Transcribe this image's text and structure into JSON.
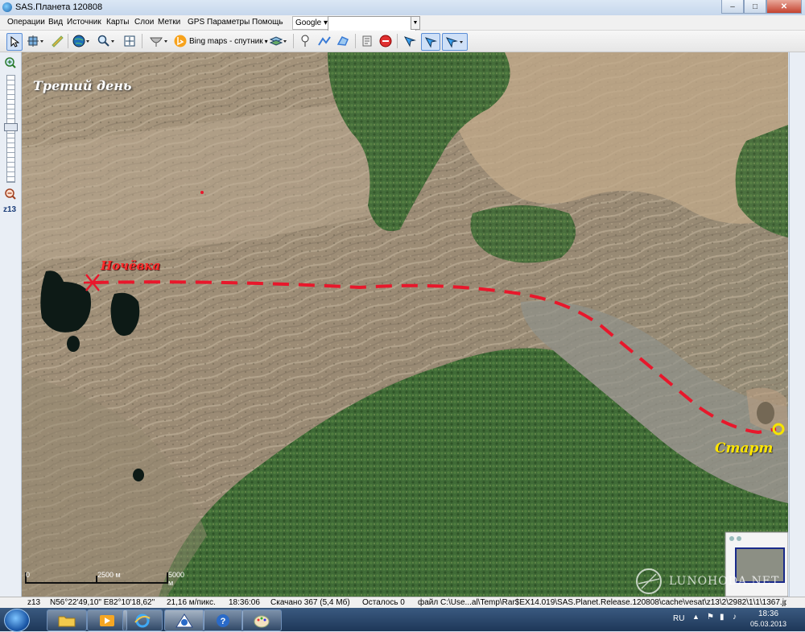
{
  "window": {
    "title": "SAS.Планета 120808",
    "minimize": "–",
    "maximize": "□",
    "close": "✕"
  },
  "menu": [
    "Операции",
    "Вид",
    "Источник",
    "Карты",
    "Слои",
    "Метки",
    "GPS",
    "Параметры",
    "Помощь"
  ],
  "search": {
    "provider": "Google",
    "value": ""
  },
  "toolbar": {
    "map_source": "Bing maps - спутник"
  },
  "icons": [
    "cursor-icon",
    "satellite-icon",
    "ruler-icon",
    "globe-icon",
    "magnifier-icon",
    "fullscreen-icon",
    "gps-dish-icon",
    "bing-icon",
    "layers-icon",
    "placemark-icon",
    "path-icon",
    "polygon-icon",
    "marks-icon",
    "stop-icon",
    "gps-arrow-icon"
  ],
  "map": {
    "annotations": {
      "day": "Третий день",
      "camp": "Ночёвка",
      "start": "Старт"
    },
    "scale": {
      "zero": "0",
      "mid": "2500 м",
      "end": "5000 м"
    },
    "watermark": "LUNOHODA.NET",
    "colors": {
      "route": "#e8172b",
      "start_marker": "#f5e400",
      "label_day": "#ffffff",
      "label_camp": "#ff2b2b",
      "label_start": "#ffe600"
    }
  },
  "zoom": {
    "level": "z13"
  },
  "status": {
    "zoom": "z13",
    "coords": "N56°22'49,10\" E82°10'18,62\"",
    "resolution": "21,16 м/пикс.",
    "time": "18:36:06",
    "downloaded": "Скачано 367 (5,4 Мб)",
    "remaining": "Осталось 0",
    "file": "файл C:\\Use...al\\Temp\\Rar$EX14.019\\SAS.Planet.Release.120808\\cache\\vesat\\z13\\2\\2982\\1\\1\\1367.jpg"
  },
  "taskbar": {
    "lang": "RU",
    "time": "18:36",
    "date": "05.03.2013"
  }
}
